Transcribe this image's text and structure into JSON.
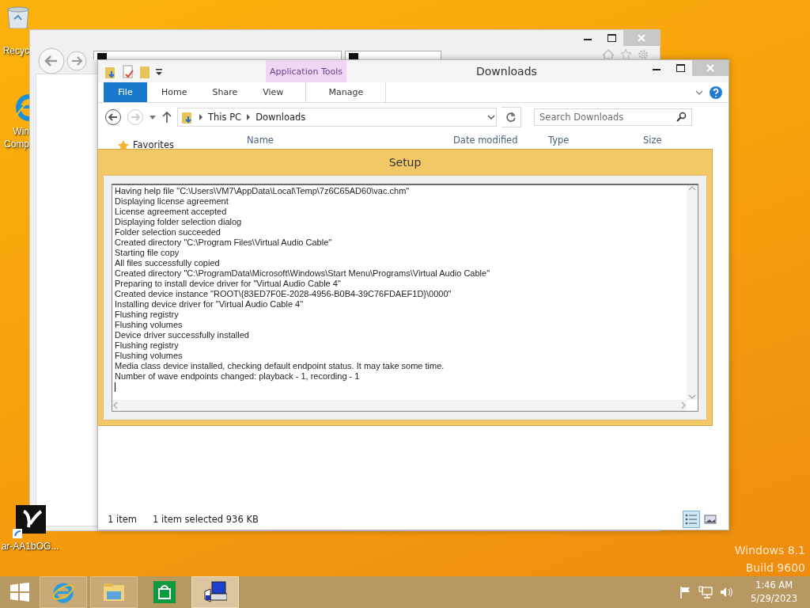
{
  "desktop": {
    "icons": [
      {
        "kind": "recycle",
        "lines": [
          "Recyc"
        ]
      },
      {
        "kind": "ie",
        "lines": [
          "Win",
          "Comp"
        ]
      },
      {
        "kind": "shortcut",
        "lines": [
          "ar-AA1bOG..."
        ]
      }
    ],
    "watermark": [
      "Windows 8.1",
      "Build 9600"
    ]
  },
  "explorer": {
    "title": "Downloads",
    "context_tab": "Application Tools",
    "ribbon_tabs": [
      {
        "label": "File",
        "kind": "file",
        "selected": false
      },
      {
        "label": "Home",
        "kind": "tab",
        "selected": false
      },
      {
        "label": "Share",
        "kind": "tab",
        "selected": false
      },
      {
        "label": "View",
        "kind": "tab",
        "selected": false
      },
      {
        "label": "Manage",
        "kind": "context",
        "selected": false
      }
    ],
    "breadcrumb": [
      "This PC",
      "Downloads"
    ],
    "search": {
      "placeholder": "Search Downloads"
    },
    "nav": [
      {
        "label": "Favorites"
      }
    ],
    "columns": [
      "Name",
      "Date modified",
      "Type",
      "Size"
    ],
    "status": {
      "count": "1 item",
      "selection": "1 item selected  936 KB"
    },
    "views": [
      {
        "kind": "details",
        "selected": true
      },
      {
        "kind": "thumbnails",
        "selected": false
      }
    ]
  },
  "setup": {
    "title": "Setup",
    "log": [
      "Having help file \"C:\\Users\\VM7\\AppData\\Local\\Temp\\7z6C65AD60\\vac.chm\"",
      "Displaying license agreement",
      "License agreement accepted",
      "Displaying folder selection dialog",
      "Folder selection succeeded",
      "Created directory \"C:\\Program Files\\Virtual Audio Cable\"",
      "Starting file copy",
      "All files successfully copied",
      "Created directory \"C:\\ProgramData\\Microsoft\\Windows\\Start Menu\\Programs\\Virtual Audio Cable\"",
      "Preparing to install device driver for \"Virtual Audio Cable 4\"",
      "Created device instance \"ROOT\\{83ED7F0E-2028-4956-B0B4-39C76FDAEF1D}\\0000\"",
      "Installing device driver for \"Virtual Audio Cable 4\"",
      "Flushing registry",
      "Flushing volumes",
      "Device driver successfully installed",
      "Flushing registry",
      "Flushing volumes",
      "Media class device installed, checking default endpoint status. It may take some time.",
      "Number of wave endpoints changed: playback - 1, recording - 1"
    ]
  },
  "taskbar": {
    "apps": [
      {
        "kind": "ie",
        "running": true,
        "active": false
      },
      {
        "kind": "explorer",
        "running": true,
        "active": false
      },
      {
        "kind": "store",
        "running": false,
        "active": false
      },
      {
        "kind": "setup",
        "running": true,
        "active": true
      }
    ],
    "clock": {
      "time": "1:46 AM",
      "date": "5/29/2023"
    }
  }
}
